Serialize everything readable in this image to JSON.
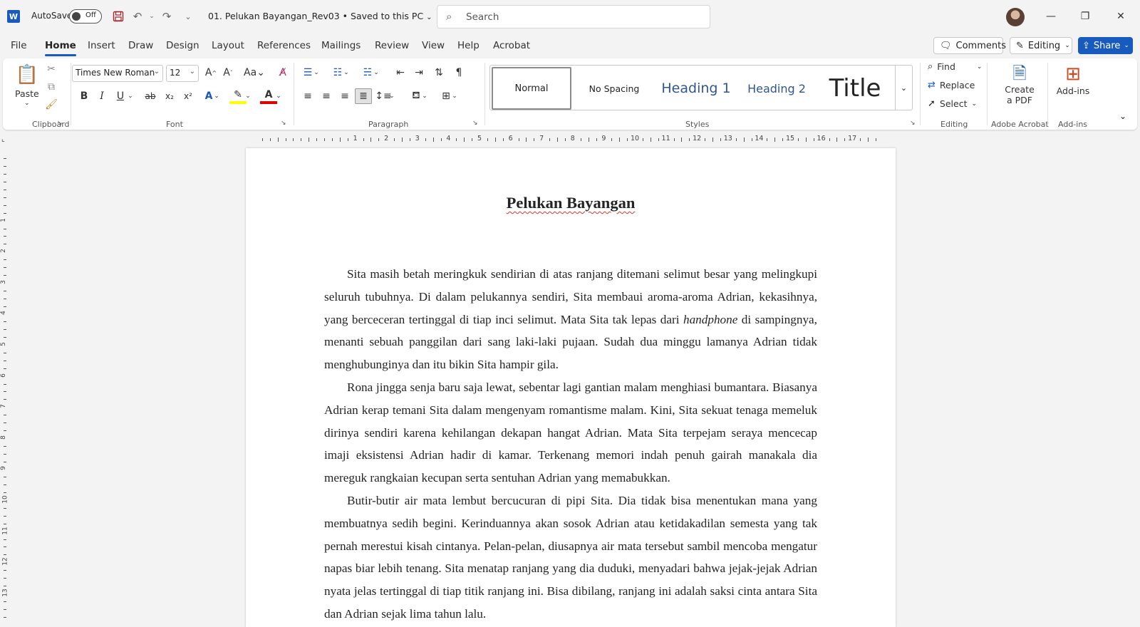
{
  "titlebar": {
    "app_icon": "W",
    "autosave_label": "AutoSave",
    "autosave_state": "Off",
    "document_title": "01. Pelukan Bayangan_Rev03 • Saved to this PC",
    "search_placeholder": "Search"
  },
  "menu": {
    "tabs": [
      "File",
      "Home",
      "Insert",
      "Draw",
      "Design",
      "Layout",
      "References",
      "Mailings",
      "Review",
      "View",
      "Help",
      "Acrobat"
    ],
    "active_tab": "Home",
    "comments_label": "Comments",
    "editing_label": "Editing",
    "share_label": "Share"
  },
  "ribbon": {
    "clipboard": {
      "paste_label": "Paste",
      "group_label": "Clipboard"
    },
    "font": {
      "font_name": "Times New Roman",
      "font_size": "12",
      "group_label": "Font"
    },
    "paragraph": {
      "group_label": "Paragraph"
    },
    "styles": {
      "items": [
        "Normal",
        "No Spacing",
        "Heading 1",
        "Heading 2",
        "Title"
      ],
      "group_label": "Styles"
    },
    "editing": {
      "find_label": "Find",
      "replace_label": "Replace",
      "select_label": "Select",
      "group_label": "Editing"
    },
    "acrobat": {
      "create_pdf_line1": "Create",
      "create_pdf_line2": "a PDF",
      "group_label": "Adobe Acrobat"
    },
    "addins": {
      "label": "Add-ins",
      "group_label": "Add-ins"
    }
  },
  "colors": {
    "accent": "#185abd",
    "highlight": "#ffff00",
    "font_color": "#e00000"
  },
  "document": {
    "heading": "Pelukan Bayangan",
    "paragraphs": [
      [
        "Sita masih betah meringkuk sendirian di atas ranjang ditemani selimut besar yang melingkupi seluruh tubuhnya. Di dalam pelukannya sendiri, Sita membaui aroma-aroma Adrian, kekasihnya, yang berceceran tertinggal di tiap inci selimut. Mata Sita tak lepas dari ",
        "handphone",
        " di sampingnya, menanti sebuah panggilan dari sang laki-laki pujaan. Sudah dua minggu lamanya Adrian tidak menghubunginya dan itu bikin Sita hampir gila."
      ],
      "Rona jingga senja baru saja lewat, sebentar lagi gantian malam menghiasi bumantara. Biasanya Adrian kerap temani Sita dalam mengenyam romantisme malam. Kini, Sita sekuat tenaga memeluk dirinya sendiri karena kehilangan dekapan hangat Adrian. Mata Sita terpejam seraya mencecap imaji eksistensi Adrian hadir di kamar. Terkenang memori indah penuh gairah manakala dia mereguk rangkaian kecupan serta sentuhan Adrian yang memabukkan.",
      "Butir-butir air mata lembut bercucuran di pipi Sita. Dia tidak bisa menentukan mana yang membuatnya sedih begini. Kerinduannya akan sosok Adrian atau ketidakadilan semesta yang tak pernah merestui kisah cintanya. Pelan-pelan, diusapnya air mata tersebut sambil mencoba mengatur napas biar lebih tenang. Sita menatap ranjang yang dia duduki, menyadari bahwa jejak-jejak Adrian nyata jelas tertinggal di tiap titik ranjang ini. Bisa dibilang, ranjang ini adalah saksi cinta antara Sita dan Adrian sejak lima tahun lalu."
    ]
  }
}
